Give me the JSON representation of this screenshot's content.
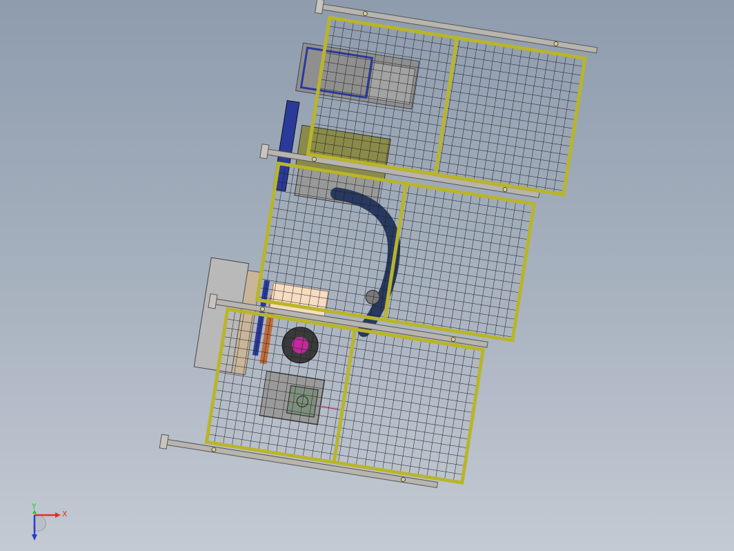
{
  "viewport": {
    "background_top": "#8e9cae",
    "background_bottom": "#c3cad3"
  },
  "colors": {
    "fence_frame": "#b9b52a",
    "fence_mesh": "#1a1a1a",
    "rail": "#b8b4ae",
    "robot": "#27395f",
    "accent_magenta": "#c02a9a",
    "panel_blue": "#2a3a9a",
    "machine_olive": "#8a8a4a",
    "machine_gray": "#9a9a9a",
    "highlight_peach": "#f6dcc0"
  },
  "triad": {
    "x_label": "X",
    "y_label": "Y",
    "x_color": "#e0302a",
    "y_color": "#2ec43a",
    "z_color": "#2a3ad0"
  }
}
